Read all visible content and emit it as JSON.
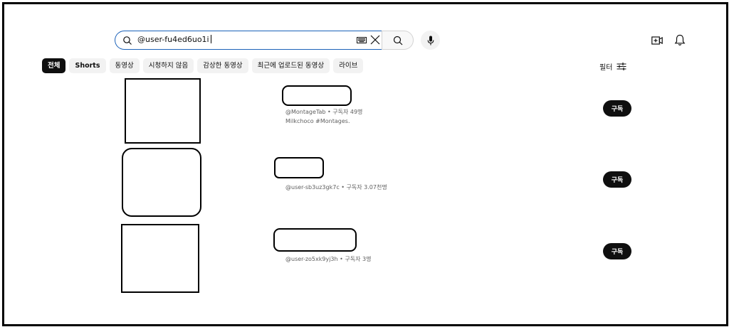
{
  "search": {
    "query": "@user-fu4ed6uo1i"
  },
  "chips": [
    "전체",
    "Shorts",
    "동영상",
    "시청하지 않음",
    "감상한 동영상",
    "최근에 업로드된 동영상",
    "라이브"
  ],
  "filter_label": "필터",
  "results": [
    {
      "handle_meta": "@MontageTab • 구독자 49명",
      "description": "Milkchoco #Montages.",
      "subscribe_label": "구독"
    },
    {
      "handle_meta": "@user-sb3uz3gk7c • 구독자 3.07천명",
      "description": "",
      "subscribe_label": "구독"
    },
    {
      "handle_meta": "@user-zo5xk9yj3h • 구독자 3명",
      "description": "",
      "subscribe_label": "구독"
    }
  ]
}
